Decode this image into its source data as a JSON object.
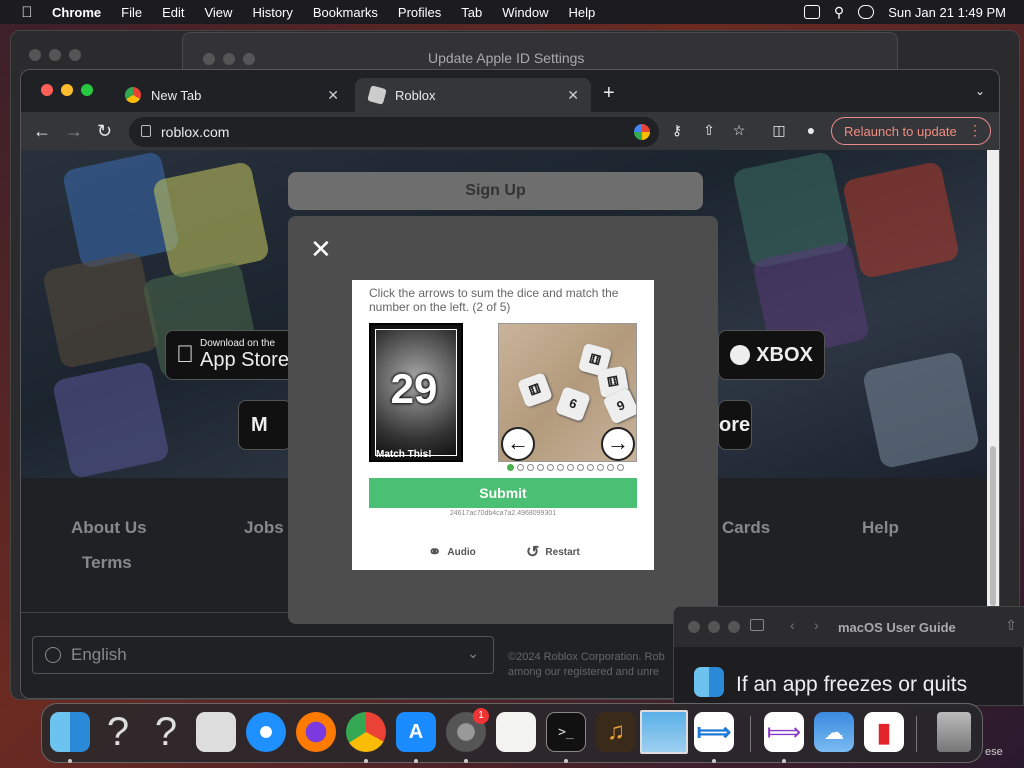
{
  "menubar": {
    "app": "Chrome",
    "items": [
      "File",
      "Edit",
      "View",
      "History",
      "Bookmarks",
      "Profiles",
      "Tab",
      "Window",
      "Help"
    ],
    "clock": "Sun Jan 21  1:49 PM"
  },
  "bg_window": {
    "title": "Update Apple ID Settings"
  },
  "browser": {
    "tabs": [
      {
        "label": "New Tab"
      },
      {
        "label": "Roblox"
      }
    ],
    "url": "roblox.com",
    "relaunch_label": "Relaunch to update"
  },
  "page": {
    "signup_label": "Sign Up",
    "stores": {
      "appstore_small": "Download on the",
      "appstore_big": "App Store",
      "xbox": "XBOX",
      "meta": "M",
      "ms_store": "ore"
    },
    "footer_links": [
      "About Us",
      "Jobs",
      "Cards",
      "Help",
      "Terms"
    ],
    "language": "English",
    "copyright_1": "©2024 Roblox Corporation. Rob",
    "copyright_2": "among our registered and unre"
  },
  "captcha": {
    "instruction": "Click the arrows to sum the dice and match the number on the left. (2 of 5)",
    "target_number": "29",
    "match_label": "Match This!",
    "dice_faces": [
      "6",
      "9",
      "9"
    ],
    "progress": {
      "total": 12,
      "current": 1
    },
    "submit_label": "Submit",
    "session_id": "24617ac70db4ca7a2.4968099301",
    "audio_label": "Audio",
    "restart_label": "Restart"
  },
  "guide_window": {
    "title": "macOS User Guide",
    "heading": "If an app freezes or quits"
  },
  "dock": {
    "apps": [
      "finder-icon",
      "unknown-app-icon",
      "unknown-app-icon",
      "launchpad-icon",
      "safari-icon",
      "firefox-icon",
      "chrome-icon",
      "app-store-icon",
      "system-settings-icon",
      "textedit-icon",
      "terminal-icon",
      "garageband-icon",
      "preview-icon",
      "vscode-icon",
      "visual-studio-icon",
      "weather-icon",
      "parallels-icon",
      "trash-icon"
    ],
    "settings_badge": "1",
    "edge_text": "ese"
  }
}
